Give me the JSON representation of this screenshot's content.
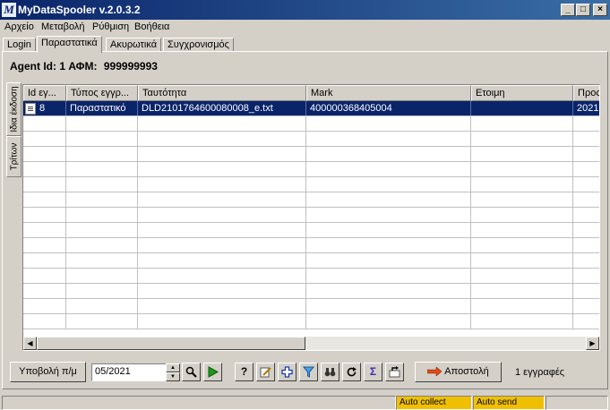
{
  "window": {
    "title": "MyDataSpooler v.2.0.3.2",
    "app_icon": "M",
    "minimize": "_",
    "maximize": "□",
    "close": "×"
  },
  "menu": [
    "Αρχείο",
    "Μεταβολή",
    "Ρύθμιση",
    "Βοήθεια"
  ],
  "tabs": [
    "Login",
    "Παραστατικά",
    "Ακυρωτικά",
    "Συγχρονισμός"
  ],
  "active_tab": "Παραστατικά",
  "agent": {
    "label": "Agent Id: 1 ΑΦΜ:",
    "afm": "999999993"
  },
  "side_tabs": [
    "Ιδια έκδοση",
    "Τρίτων"
  ],
  "table": {
    "columns": [
      "Id εγ...",
      "Τύπος εγγρ...",
      "Ταυτότητα",
      "Mark",
      "Ετοιμη",
      "Προς"
    ],
    "rows": [
      {
        "id": "8",
        "type": "Παραστατικό",
        "identity": "DLD2101764600080008_e.txt",
        "mark": "400000368405004",
        "ready": "",
        "pros": "2021"
      }
    ]
  },
  "toolbar": {
    "submit_label": "Υποβολή π/μ",
    "period": "05/2021",
    "send_label": "Αποστολή",
    "record_count": "1 εγγραφές",
    "help_glyph": "?",
    "sigma_glyph": "Σ"
  },
  "status": {
    "auto_collect": "Auto collect",
    "auto_send": "Auto send"
  },
  "colors": {
    "title_bar": "#0a246a",
    "selection": "#0a246a",
    "status_yellow": "#f0c000",
    "play_green": "#1a9a1a"
  }
}
